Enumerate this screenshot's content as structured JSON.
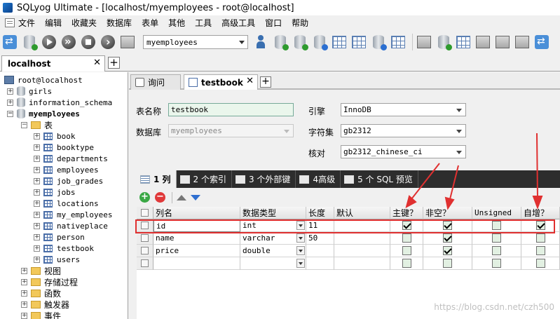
{
  "window": {
    "title": "SQLyog Ultimate - [localhost/myemployees - root@localhost]"
  },
  "menu": [
    "文件",
    "编辑",
    "收藏夹",
    "数据库",
    "表单",
    "其他",
    "工具",
    "高级工具",
    "窗口",
    "帮助"
  ],
  "toolbar": {
    "database_select": "myemployees"
  },
  "connection_tab": {
    "label": "localhost"
  },
  "tree": {
    "root": "root@localhost",
    "databases": [
      "girls",
      "information_schema",
      "myemployees"
    ],
    "tables_folder": "表",
    "tables": [
      "book",
      "booktype",
      "departments",
      "employees",
      "job_grades",
      "jobs",
      "locations",
      "my_employees",
      "nativeplace",
      "person",
      "testbook",
      "users"
    ],
    "folders": [
      "视图",
      "存储过程",
      "函数",
      "触发器",
      "事件"
    ]
  },
  "editor_tabs": {
    "query": "询问",
    "table": "testbook"
  },
  "form": {
    "table_name_label": "表名称",
    "table_name": "testbook",
    "database_label": "数据库",
    "database": "myemployees",
    "engine_label": "引擎",
    "engine": "InnoDB",
    "charset_label": "字符集",
    "charset": "gb2312",
    "collation_label": "核对",
    "collation": "gb2312_chinese_ci"
  },
  "subtabs": [
    "1 列",
    "2 个索引",
    "3 个外部键",
    "4高级",
    "5 个 SQL 预览"
  ],
  "grid": {
    "headers": [
      "列名",
      "数据类型",
      "长度",
      "默认",
      "主键？",
      "非空？",
      "Unsigned",
      "自增？"
    ],
    "rows": [
      {
        "name": "id",
        "type": "int",
        "length": "11",
        "default": "",
        "pk": true,
        "notnull": true,
        "unsigned": false,
        "autoinc": true
      },
      {
        "name": "name",
        "type": "varchar",
        "length": "50",
        "default": "",
        "pk": false,
        "notnull": true,
        "unsigned": false,
        "autoinc": false
      },
      {
        "name": "price",
        "type": "double",
        "length": "",
        "default": "",
        "pk": false,
        "notnull": true,
        "unsigned": false,
        "autoinc": false
      },
      {
        "name": "",
        "type": "",
        "length": "",
        "default": "",
        "pk": false,
        "notnull": false,
        "unsigned": false,
        "autoinc": false
      }
    ]
  },
  "watermark": "https://blog.csdn.net/czh500",
  "colors": {
    "annotation_red": "#e03030",
    "subtab_bar": "#2d2d2d",
    "checkbox_bg": "#e2f0e2"
  }
}
